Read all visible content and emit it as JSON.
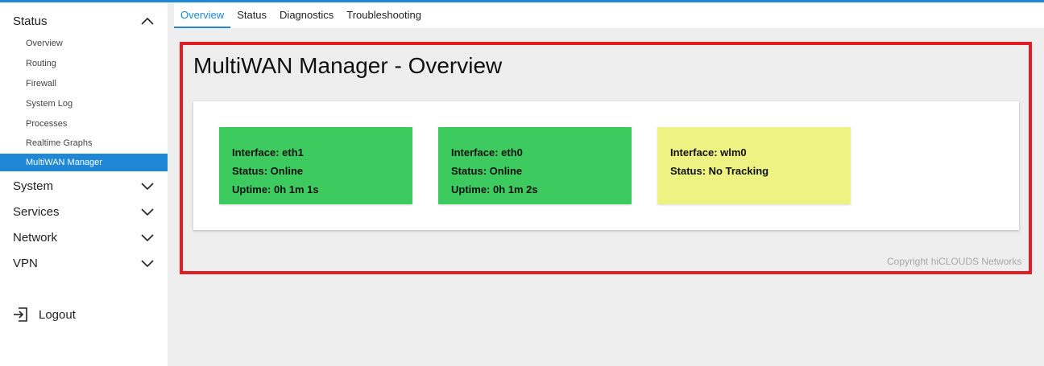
{
  "sidebar": {
    "groups": [
      {
        "label": "Status",
        "expanded": true
      },
      {
        "label": "System",
        "expanded": false
      },
      {
        "label": "Services",
        "expanded": false
      },
      {
        "label": "Network",
        "expanded": false
      },
      {
        "label": "VPN",
        "expanded": false
      }
    ],
    "status_items": [
      "Overview",
      "Routing",
      "Firewall",
      "System Log",
      "Processes",
      "Realtime Graphs",
      "MultiWAN Manager"
    ],
    "active_item": "MultiWAN Manager",
    "logout_label": "Logout"
  },
  "tabs": [
    {
      "label": "Overview",
      "active": true
    },
    {
      "label": "Status",
      "active": false
    },
    {
      "label": "Diagnostics",
      "active": false
    },
    {
      "label": "Troubleshooting",
      "active": false
    }
  ],
  "main": {
    "title": "MultiWAN Manager - Overview",
    "interfaces": [
      {
        "interface": "Interface: eth1",
        "status": "Status: Online",
        "uptime": "Uptime: 0h 1m 1s",
        "color": "#3dca5e"
      },
      {
        "interface": "Interface: eth0",
        "status": "Status: Online",
        "uptime": "Uptime: 0h 1m 2s",
        "color": "#3dca5e"
      },
      {
        "interface": "Interface: wlm0",
        "status": "Status: No Tracking",
        "color": "#ecf383"
      }
    ],
    "copyright": "Copyright hiCLOUDS Networks"
  },
  "colors": {
    "accent": "#1e88d6",
    "highlight_border": "#e21d23",
    "online": "#3dca5e",
    "no_tracking": "#ecf383"
  }
}
